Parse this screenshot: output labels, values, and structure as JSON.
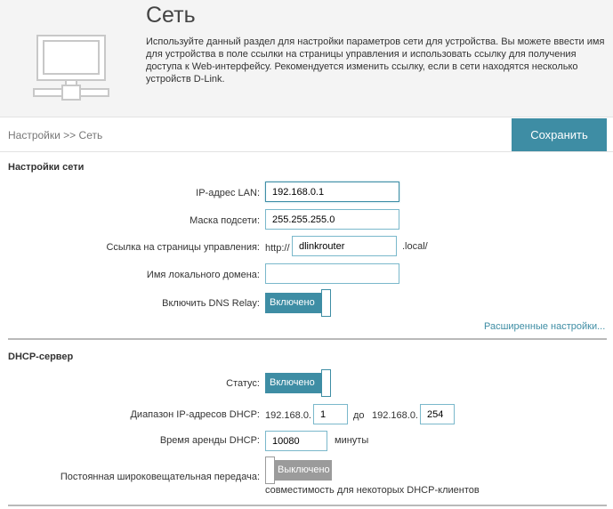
{
  "header": {
    "title": "Сеть",
    "description": "Используйте данный раздел для настройки параметров сети для устройства. Вы можете ввести имя для устройства в поле ссылки на страницы управления и использовать ссылку для получения доступа к Web-интерфейсу. Рекомендуется изменить ссылку, если в сети находятся несколько устройств D-Link.",
    "icon": "network-computer-icon"
  },
  "breadcrumb": "Настройки >> Сеть",
  "toolbar": {
    "save_label": "Сохранить"
  },
  "network_settings": {
    "section_title": "Настройки сети",
    "lan_ip_label": "IP-адрес LAN:",
    "lan_ip_value": "192.168.0.1",
    "subnet_label": "Маска подсети:",
    "subnet_value": "255.255.255.0",
    "mgmt_link_label": "Ссылка на страницы управления:",
    "mgmt_link_prefix": "http://",
    "mgmt_link_value": "dlinkrouter",
    "mgmt_link_suffix": ".local/",
    "local_domain_label": "Имя локального домена:",
    "local_domain_value": "",
    "dns_relay_label": "Включить DNS Relay:",
    "dns_relay_state": "Включено",
    "advanced_link": "Расширенные настройки..."
  },
  "dhcp": {
    "section_title": "DHCP-сервер",
    "status_label": "Статус:",
    "status_state": "Включено",
    "range_label": "Диапазон IP-адресов DHCP:",
    "range_prefix_1": "192.168.0.",
    "range_start": "1",
    "range_to": "до",
    "range_prefix_2": "192.168.0.",
    "range_end": "254",
    "lease_label": "Время аренды DHCP:",
    "lease_value": "10080",
    "lease_unit": "минуты",
    "broadcast_label": "Постоянная широковещательная передача:",
    "broadcast_state": "Выключено",
    "broadcast_note": "совместимость для некоторых DHCP-клиентов"
  },
  "colors": {
    "accent": "#3e8da4",
    "off": "#9b9b9b",
    "header_bg": "#f4f4f4"
  }
}
